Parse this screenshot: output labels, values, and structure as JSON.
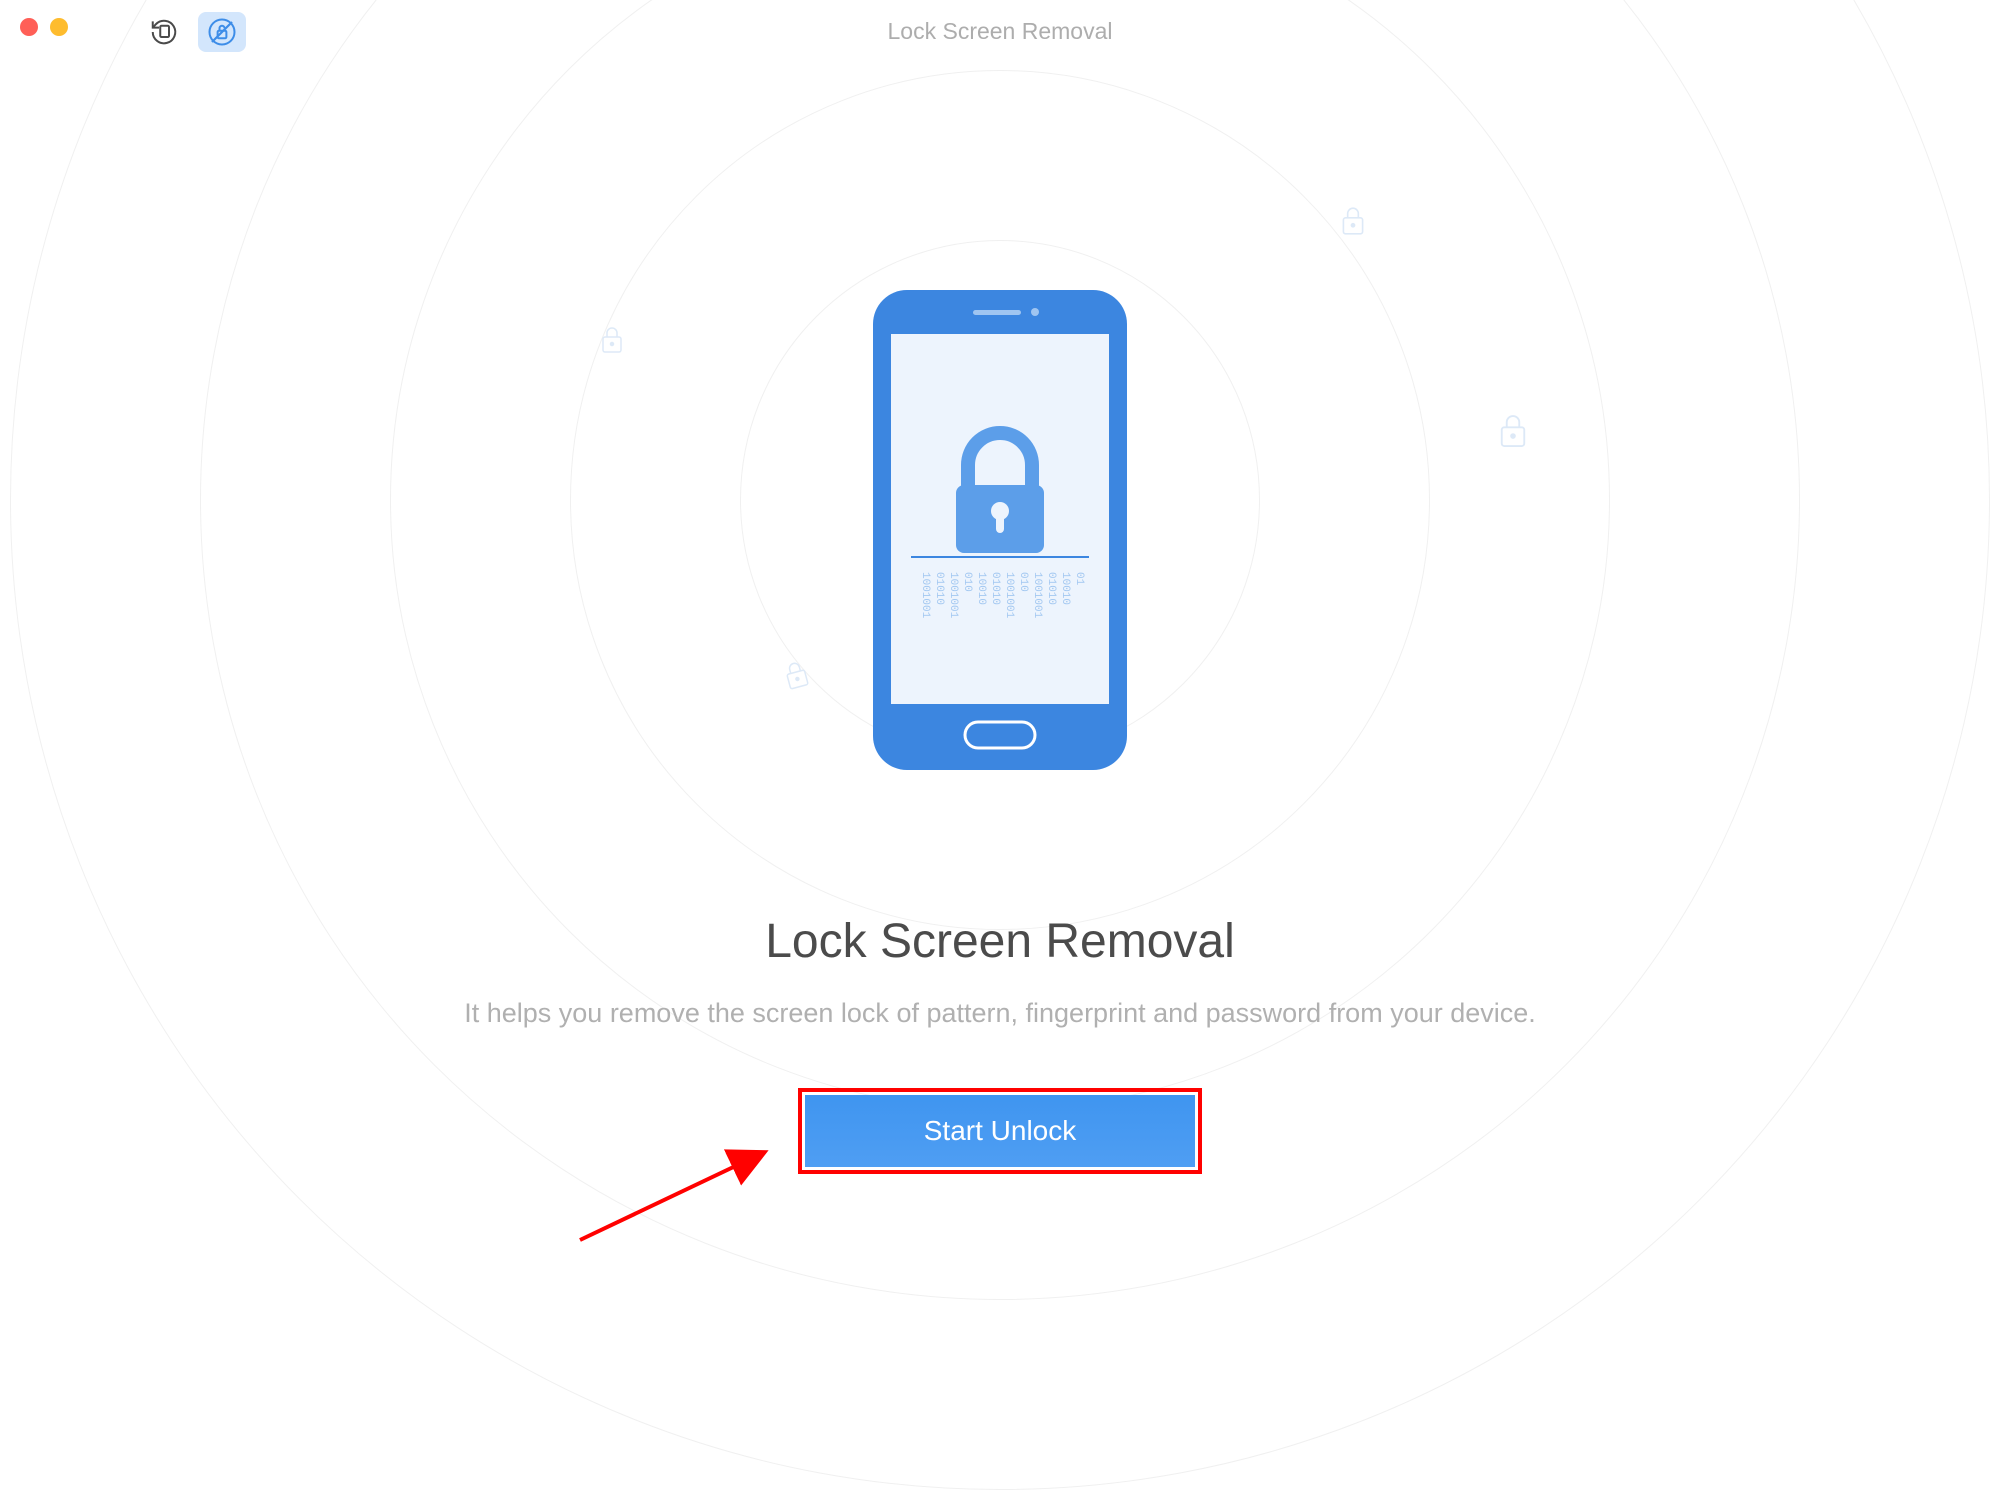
{
  "window": {
    "title": "Lock Screen Removal"
  },
  "main": {
    "heading": "Lock Screen Removal",
    "description": "It helps you remove the screen lock of pattern, fingerprint and password from your device.",
    "button_label": "Start Unlock"
  },
  "colors": {
    "accent": "#4f9ef3",
    "highlight": "#ff0100",
    "text_dark": "#4b4b4b",
    "text_muted": "#b0b0b0"
  },
  "icons": {
    "toolbar_history": "history-icon",
    "toolbar_unlock": "unlock-icon",
    "phone_lock": "lock-icon"
  }
}
